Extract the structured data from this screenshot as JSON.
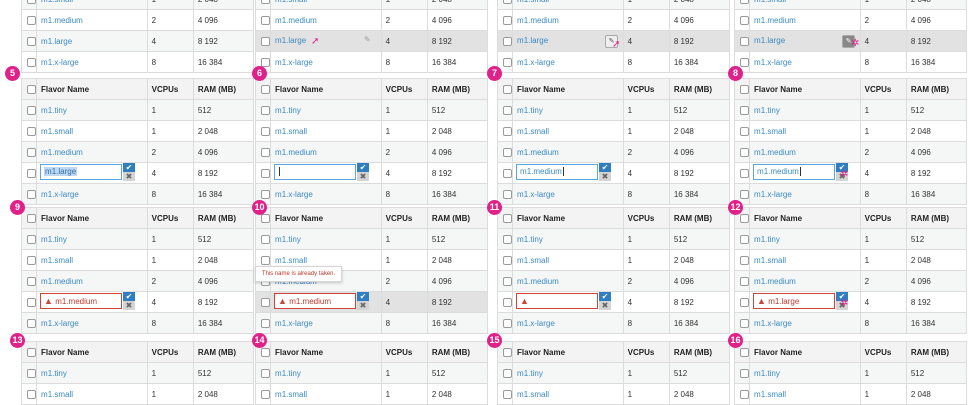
{
  "headers": [
    "Flavor Name",
    "VCPUs",
    "RAM (MB)"
  ],
  "flavors": [
    {
      "name": "m1.tiny",
      "vcpus": "1",
      "ram": "512"
    },
    {
      "name": "m1.small",
      "vcpus": "1",
      "ram": "2 048"
    },
    {
      "name": "m1.medium",
      "vcpus": "2",
      "ram": "4 096"
    },
    {
      "name": "m1.large",
      "vcpus": "4",
      "ram": "8 192"
    },
    {
      "name": "m1.x-large",
      "vcpus": "8",
      "ram": "16 384"
    }
  ],
  "steps": [
    "5",
    "6",
    "7",
    "8",
    "9",
    "10",
    "11",
    "12",
    "13",
    "14",
    "15",
    "16"
  ],
  "edits": {
    "s5": "m1.large",
    "s7": "m1.medium",
    "s8": "m1.medium",
    "s9": "m1.medium",
    "s10": "m1.medium",
    "s12": "m1.large"
  },
  "tooltip": "This name is already taken.",
  "icons": {
    "warning": "warning-icon",
    "check": "check-icon",
    "cancel": "cancel-icon",
    "pencil": "pencil-icon",
    "cursor": "mouse-cursor-icon"
  },
  "colors": {
    "link": "#3a8ac6",
    "badge": "#e0218a",
    "error": "#d04437",
    "confirm": "#2f7ec4"
  }
}
